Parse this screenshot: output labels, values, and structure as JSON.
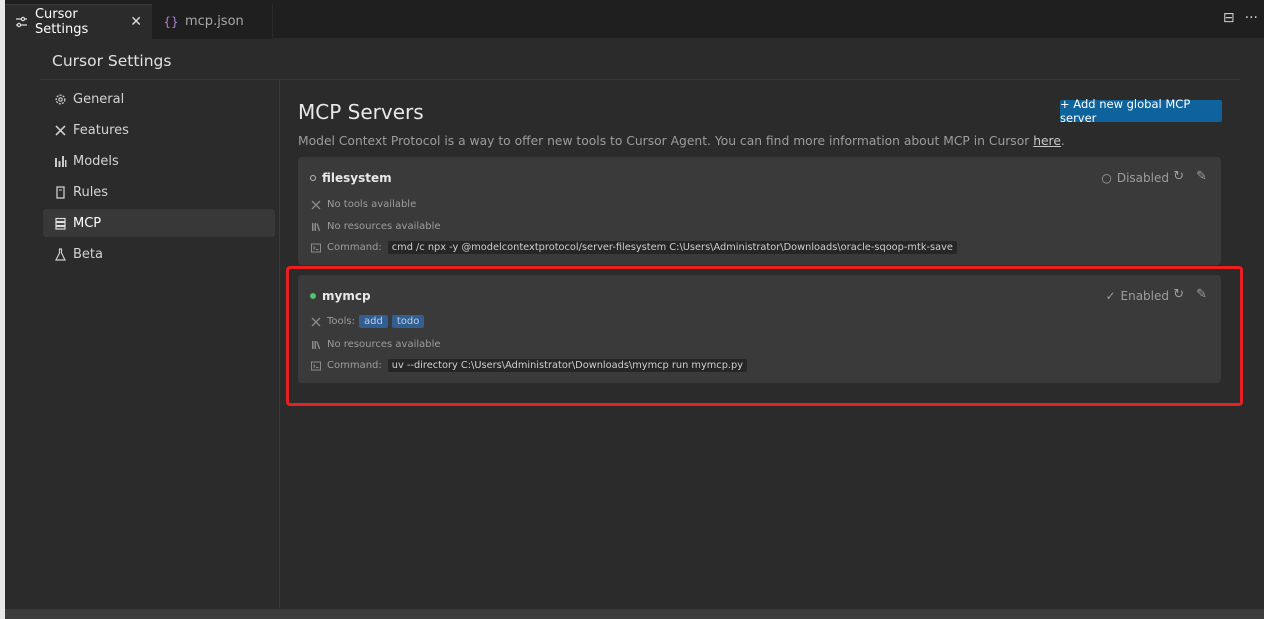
{
  "tabs": [
    {
      "label": "Cursor Settings",
      "icon": "settings-sliders-icon",
      "active": true
    },
    {
      "label": "mcp.json",
      "icon": "json-braces-icon",
      "active": false
    }
  ],
  "tab_actions": [
    {
      "icon": "split-editor-icon",
      "glyph": "⊟"
    },
    {
      "icon": "more-icon",
      "glyph": "···"
    }
  ],
  "settings": {
    "title": "Cursor Settings"
  },
  "sidebar": {
    "items": [
      {
        "label": "General",
        "icon": "gear-icon"
      },
      {
        "label": "Features",
        "icon": "tools-icon"
      },
      {
        "label": "Models",
        "icon": "chart-bars-icon"
      },
      {
        "label": "Rules",
        "icon": "book-icon"
      },
      {
        "label": "MCP",
        "icon": "server-icon",
        "selected": true
      },
      {
        "label": "Beta",
        "icon": "flask-icon"
      }
    ]
  },
  "main": {
    "title": "MCP Servers",
    "add_button": "+ Add new global MCP server",
    "description": "Model Context Protocol is a way to offer new tools to Cursor Agent. You can find more information about MCP in Cursor",
    "description_link": "here",
    "description_end": "."
  },
  "servers": [
    {
      "name": "filesystem",
      "status": "Disabled",
      "tools_text": "No tools available",
      "resources_text": "No resources available",
      "command_label": "Command:",
      "command": "cmd /c npx -y @modelcontextprotocol/server-filesystem C:\\Users\\Administrator\\Downloads\\oracle-sqoop-mtk-save"
    },
    {
      "name": "mymcp",
      "status": "Enabled",
      "tools_label": "Tools:",
      "tools": [
        "add",
        "todo"
      ],
      "resources_text": "No resources available",
      "command_label": "Command:",
      "command": "uv --directory C:\\Users\\Administrator\\Downloads\\mymcp run mymcp.py"
    }
  ],
  "colors": {
    "accent_button": "#0e639c",
    "enabled_dot": "#4ec26a",
    "highlight": "#e8201f",
    "tag": "#325e92"
  }
}
